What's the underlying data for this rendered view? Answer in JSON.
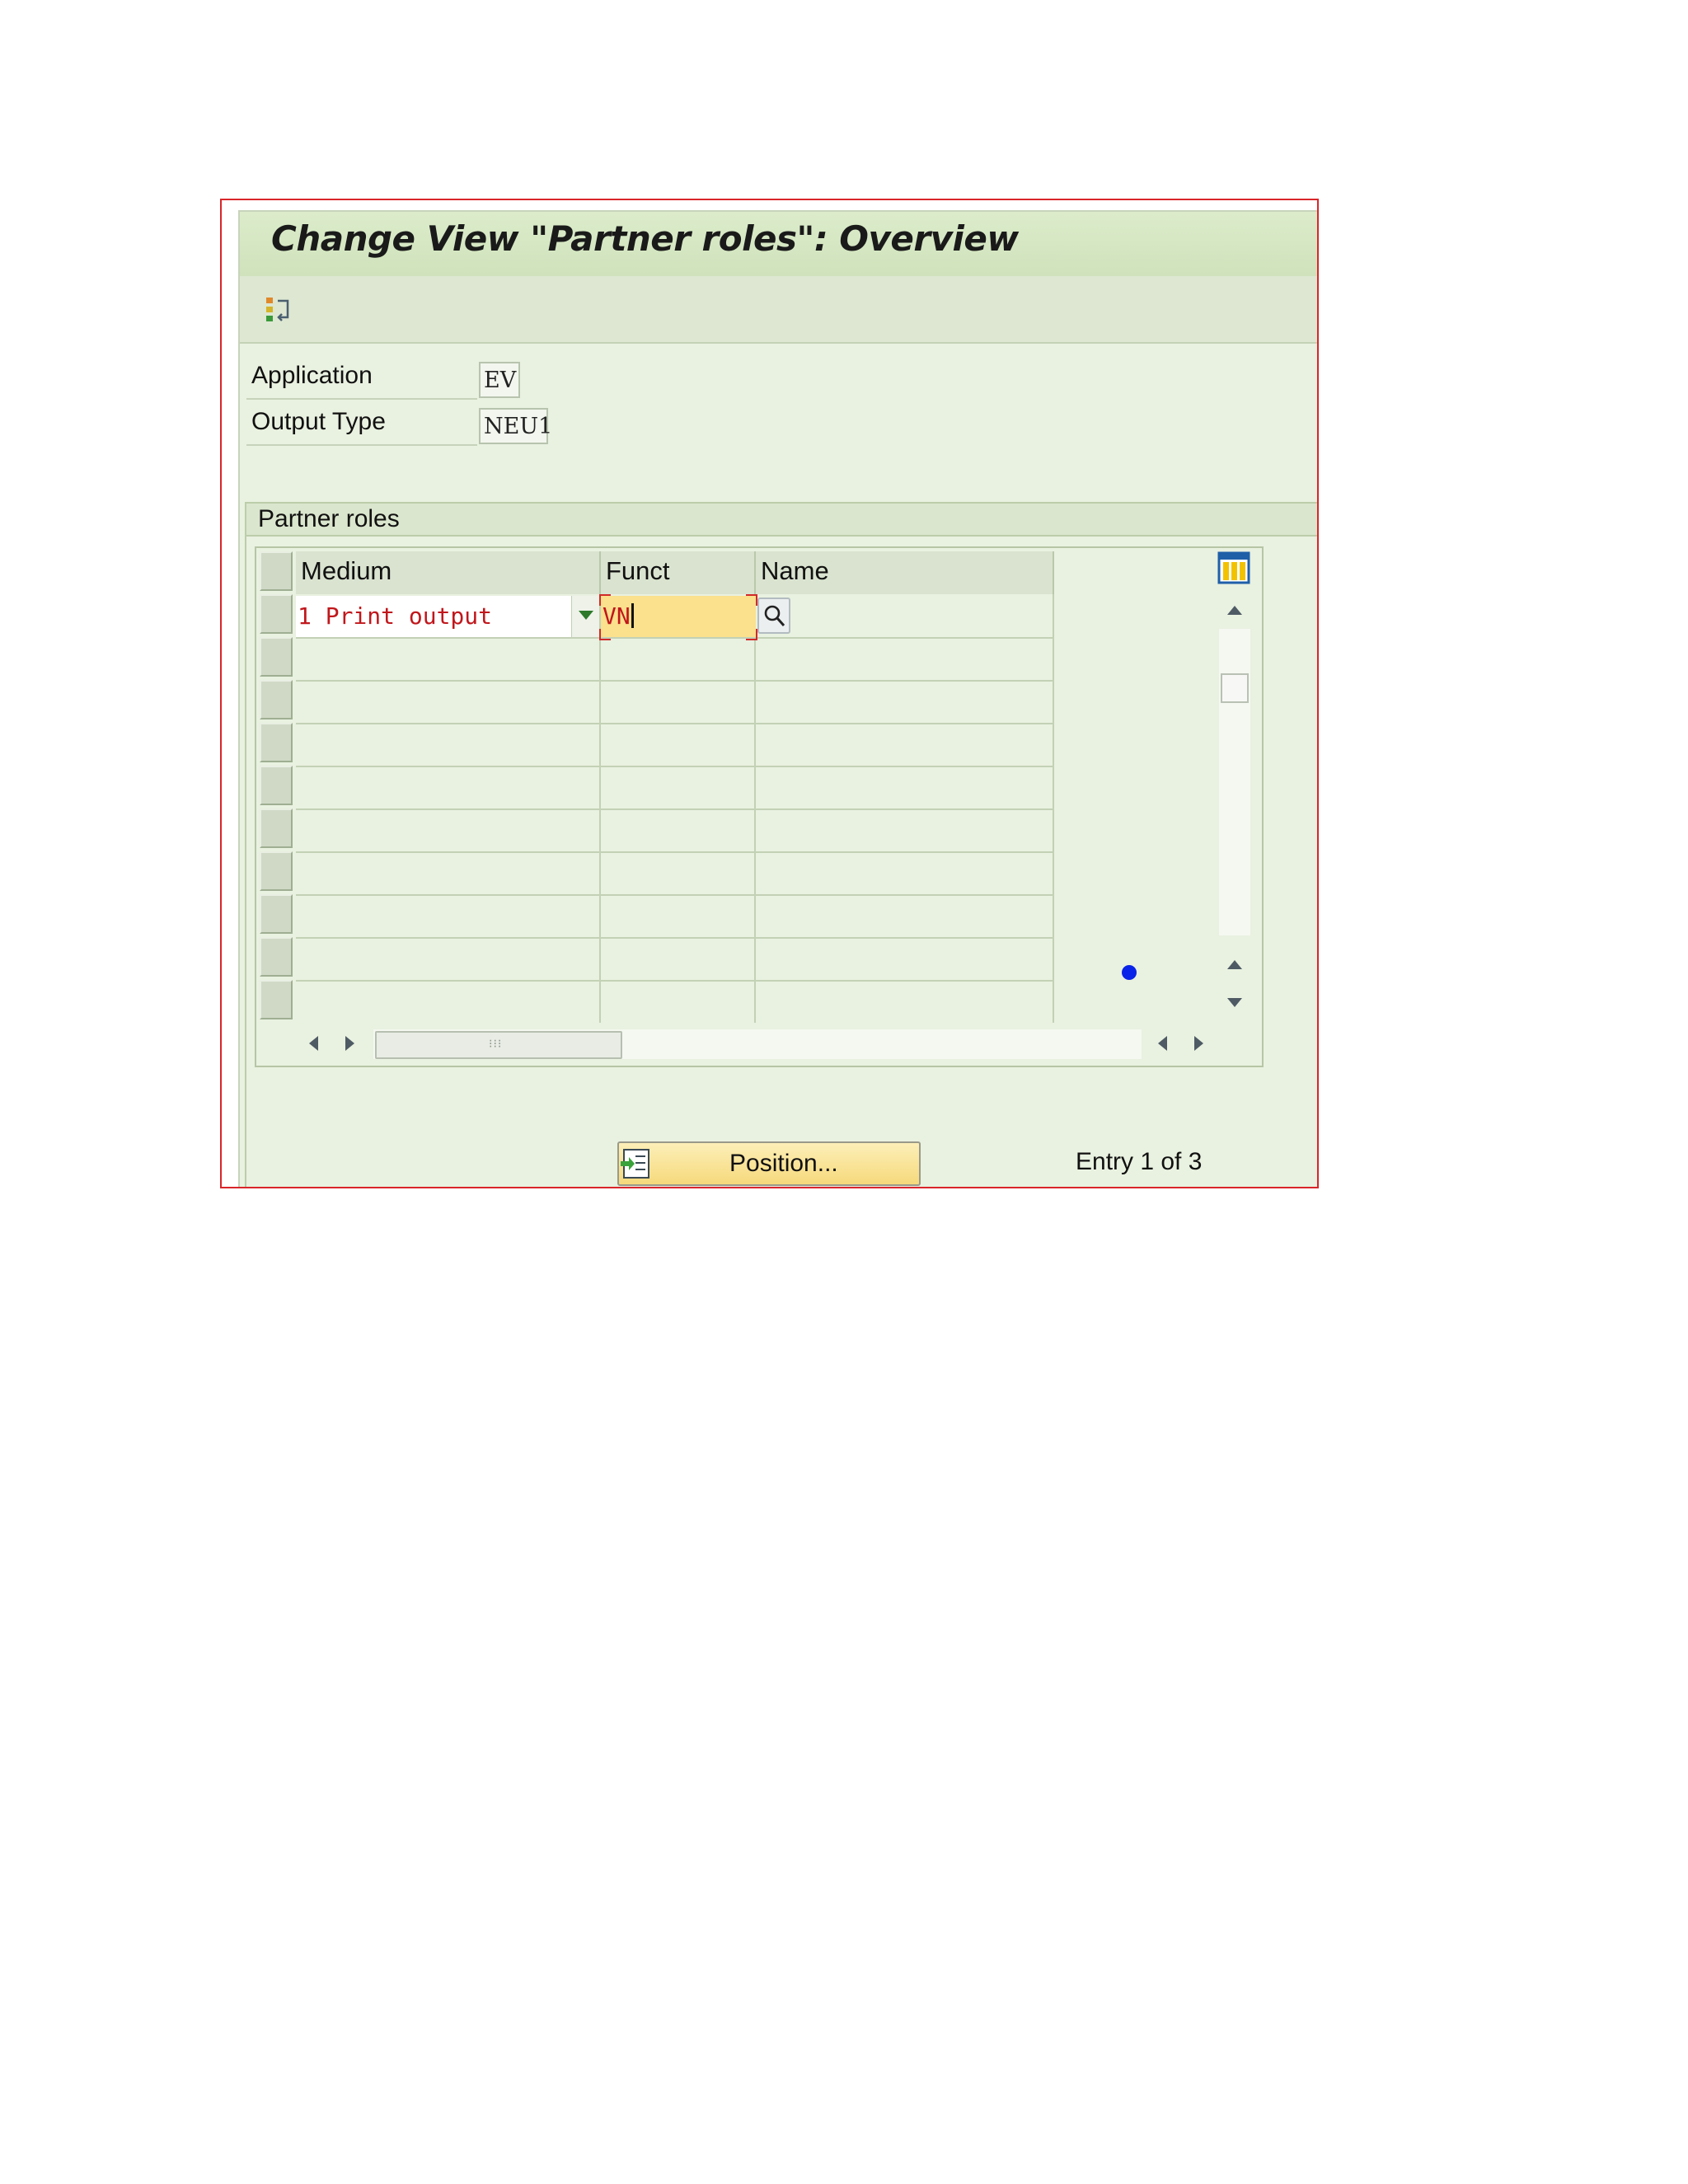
{
  "window": {
    "title": "Change View \"Partner roles\": Overview"
  },
  "header_fields": [
    {
      "label": "Application",
      "value": "EV"
    },
    {
      "label": "Output Type",
      "value": "NEU1"
    }
  ],
  "group": {
    "title": "Partner roles"
  },
  "table": {
    "columns": [
      "Medium",
      "Funct",
      "Name"
    ],
    "rows": [
      {
        "medium": "1 Print output",
        "funct": "VN",
        "name": ""
      }
    ]
  },
  "footer": {
    "position_label": "Position...",
    "entry_text": "Entry 1 of 3"
  },
  "colors": {
    "accent_input": "#fbe08d",
    "error_text": "#c0171c",
    "background": "#e9f1e0"
  },
  "icons": [
    "overview-toggle-icon",
    "table-settings-icon",
    "search-help-icon",
    "position-icon"
  ]
}
